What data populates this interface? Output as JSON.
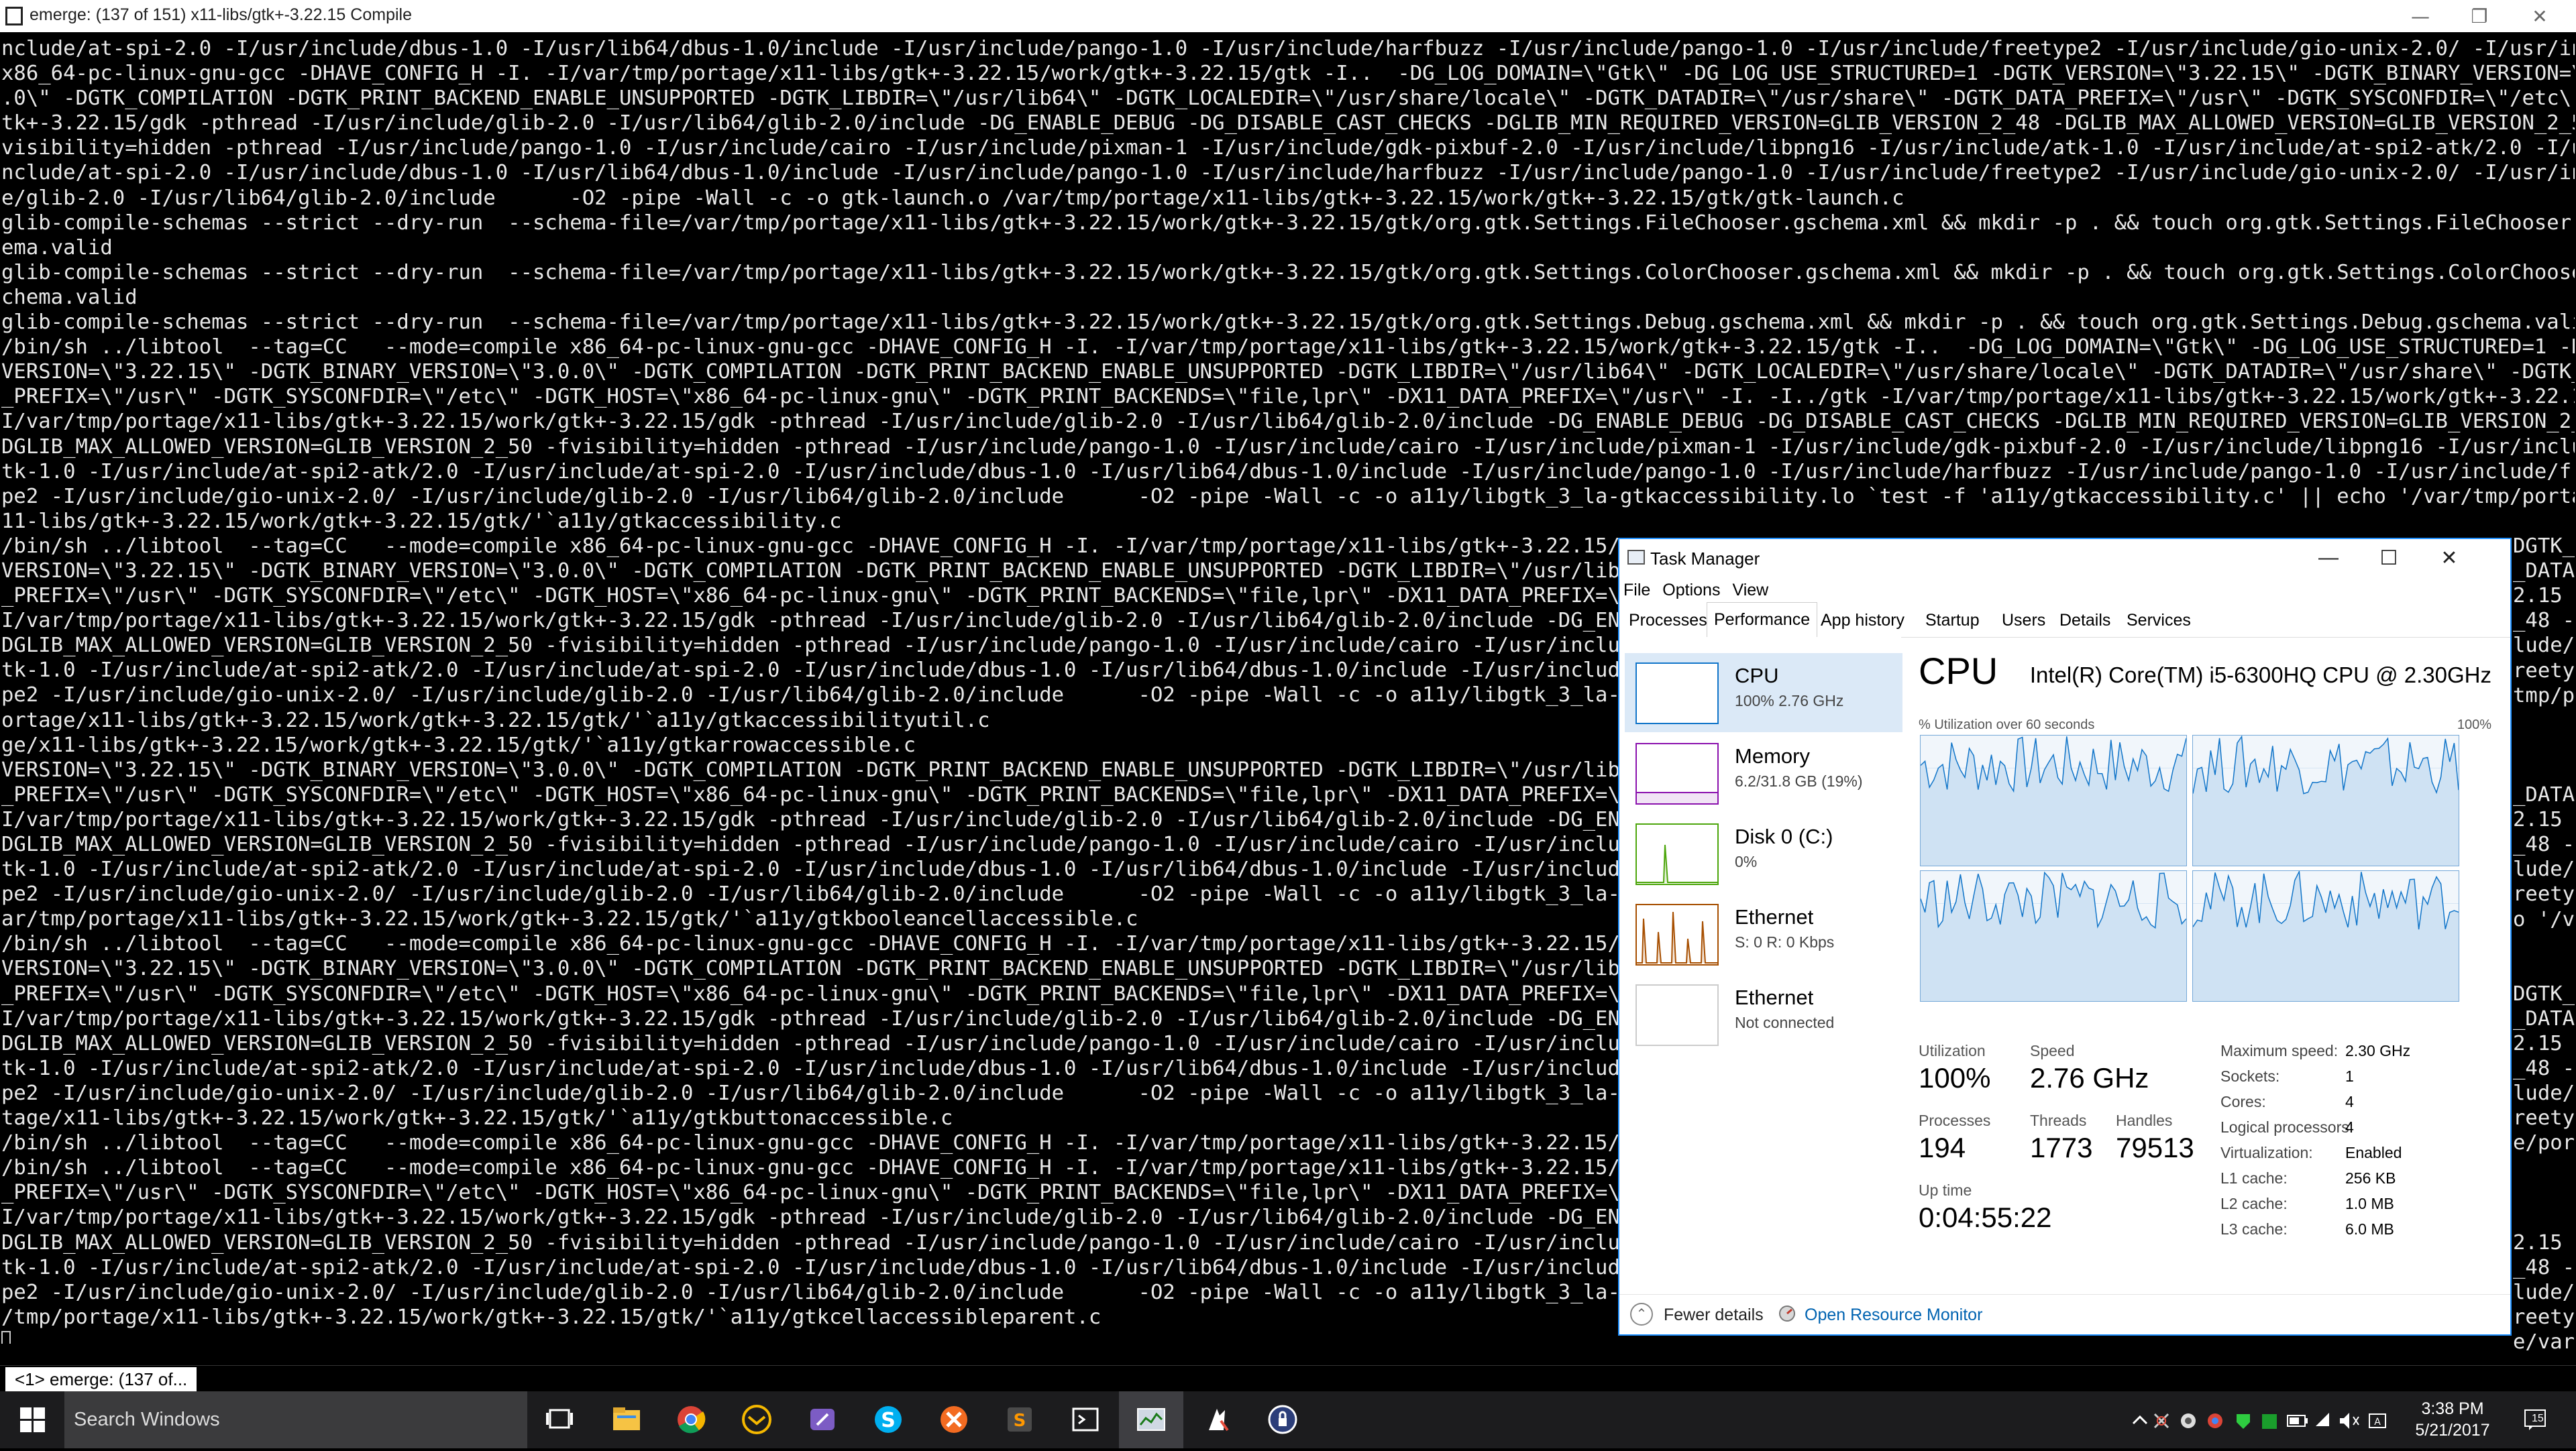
{
  "terminal": {
    "title": "emerge: (137 of 151) x11-libs/gtk+-3.22.15 Compile",
    "tab_label": "<1> emerge: (137 of...",
    "lines": [
      "nclude/at-spi-2.0 -I/usr/include/dbus-1.0 -I/usr/lib64/dbus-1.0/include -I/usr/include/pango-1.0 -I/usr/include/harfbuzz -I/usr/include/pango-1.0 -I/usr/include/freetype2 -I/usr/include/gio-unix-2.0/ -I/usr/includ",
      "x86_64-pc-linux-gnu-gcc -DHAVE_CONFIG_H -I. -I/var/tmp/portage/x11-libs/gtk+-3.22.15/work/gtk+-3.22.15/gtk -I..  -DG_LOG_DOMAIN=\\\"Gtk\\\" -DG_LOG_USE_STRUCTURED=1 -DGTK_VERSION=\\\"3.22.15\\\" -DGTK_BINARY_VERSION=\\\"3.0",
      ".0\\\" -DGTK_COMPILATION -DGTK_PRINT_BACKEND_ENABLE_UNSUPPORTED -DGTK_LIBDIR=\\\"/usr/lib64\\\" -DGTK_LOCALEDIR=\\\"/usr/share/locale\\\" -DGTK_DATADIR=\\\"/usr/share\\\" -DGTK_DATA_PREFIX=\\\"/usr\\\" -DGTK_SYSCONFDIR=\\\"/etc\\\" -D",
      "tk+-3.22.15/gdk -pthread -I/usr/include/glib-2.0 -I/usr/lib64/glib-2.0/include -DG_ENABLE_DEBUG -DG_DISABLE_CAST_CHECKS -DGLIB_MIN_REQUIRED_VERSION=GLIB_VERSION_2_48 -DGLIB_MAX_ALLOWED_VERSION=GLIB_VERSION_2_50 -f",
      "visibility=hidden -pthread -I/usr/include/pango-1.0 -I/usr/include/cairo -I/usr/include/pixman-1 -I/usr/include/gdk-pixbuf-2.0 -I/usr/include/libpng16 -I/usr/include/atk-1.0 -I/usr/include/at-spi2-atk/2.0 -I/usr/i",
      "nclude/at-spi-2.0 -I/usr/include/dbus-1.0 -I/usr/lib64/dbus-1.0/include -I/usr/include/pango-1.0 -I/usr/include/harfbuzz -I/usr/include/pango-1.0 -I/usr/include/freetype2 -I/usr/include/gio-unix-2.0/ -I/usr/includ",
      "e/glib-2.0 -I/usr/lib64/glib-2.0/include      -O2 -pipe -Wall -c -o gtk-launch.o /var/tmp/portage/x11-libs/gtk+-3.22.15/work/gtk+-3.22.15/gtk/gtk-launch.c",
      "glib-compile-schemas --strict --dry-run  --schema-file=/var/tmp/portage/x11-libs/gtk+-3.22.15/work/gtk+-3.22.15/gtk/org.gtk.Settings.FileChooser.gschema.xml && mkdir -p . && touch org.gtk.Settings.FileChooser.gsch",
      "ema.valid",
      "glib-compile-schemas --strict --dry-run  --schema-file=/var/tmp/portage/x11-libs/gtk+-3.22.15/work/gtk+-3.22.15/gtk/org.gtk.Settings.ColorChooser.gschema.xml && mkdir -p . && touch org.gtk.Settings.ColorChooser.gs",
      "chema.valid",
      "glib-compile-schemas --strict --dry-run  --schema-file=/var/tmp/portage/x11-libs/gtk+-3.22.15/work/gtk+-3.22.15/gtk/org.gtk.Settings.Debug.gschema.xml && mkdir -p . && touch org.gtk.Settings.Debug.gschema.valid",
      "/bin/sh ../libtool  --tag=CC   --mode=compile x86_64-pc-linux-gnu-gcc -DHAVE_CONFIG_H -I. -I/var/tmp/portage/x11-libs/gtk+-3.22.15/work/gtk+-3.22.15/gtk -I..  -DG_LOG_DOMAIN=\\\"Gtk\\\" -DG_LOG_USE_STRUCTURED=1 -DGTK_",
      "VERSION=\\\"3.22.15\\\" -DGTK_BINARY_VERSION=\\\"3.0.0\\\" -DGTK_COMPILATION -DGTK_PRINT_BACKEND_ENABLE_UNSUPPORTED -DGTK_LIBDIR=\\\"/usr/lib64\\\" -DGTK_LOCALEDIR=\\\"/usr/share/locale\\\" -DGTK_DATADIR=\\\"/usr/share\\\" -DGTK_DATA",
      "_PREFIX=\\\"/usr\\\" -DGTK_SYSCONFDIR=\\\"/etc\\\" -DGTK_HOST=\\\"x86_64-pc-linux-gnu\\\" -DGTK_PRINT_BACKENDS=\\\"file,lpr\\\" -DX11_DATA_PREFIX=\\\"/usr\\\" -I. -I../gtk -I/var/tmp/portage/x11-libs/gtk+-3.22.15/work/gtk+-3.22.15",
      "I/var/tmp/portage/x11-libs/gtk+-3.22.15/work/gtk+-3.22.15/gdk -pthread -I/usr/include/glib-2.0 -I/usr/lib64/glib-2.0/include -DG_ENABLE_DEBUG -DG_DISABLE_CAST_CHECKS -DGLIB_MIN_REQUIRED_VERSION=GLIB_VERSION_2_48 -",
      "DGLIB_MAX_ALLOWED_VERSION=GLIB_VERSION_2_50 -fvisibility=hidden -pthread -I/usr/include/pango-1.0 -I/usr/include/cairo -I/usr/include/pixman-1 -I/usr/include/gdk-pixbuf-2.0 -I/usr/include/libpng16 -I/usr/include/a",
      "tk-1.0 -I/usr/include/at-spi2-atk/2.0 -I/usr/include/at-spi-2.0 -I/usr/include/dbus-1.0 -I/usr/lib64/dbus-1.0/include -I/usr/include/pango-1.0 -I/usr/include/harfbuzz -I/usr/include/pango-1.0 -I/usr/include/freety",
      "pe2 -I/usr/include/gio-unix-2.0/ -I/usr/include/glib-2.0 -I/usr/lib64/glib-2.0/include      -O2 -pipe -Wall -c -o a11y/libgtk_3_la-gtkaccessibility.lo `test -f 'a11y/gtkaccessibility.c' || echo '/var/tmp/portage/x",
      "11-libs/gtk+-3.22.15/work/gtk+-3.22.15/gtk/'`a11y/gtkaccessibility.c",
      "/bin/sh ../libtool  --tag=CC   --mode=compile x86_64-pc-linux-gnu-gcc -DHAVE_CONFIG_H -I. -I/var/tmp/portage/x11-libs/gtk+-3.22.15/wor",
      "VERSION=\\\"3.22.15\\\" -DGTK_BINARY_VERSION=\\\"3.0.0\\\" -DGTK_COMPILATION -DGTK_PRINT_BACKEND_ENABLE_UNSUPPORTED -DGTK_LIBDIR=\\\"/usr/lib64",
      "_PREFIX=\\\"/usr\\\" -DGTK_SYSCONFDIR=\\\"/etc\\\" -DGTK_HOST=\\\"x86_64-pc-linux-gnu\\\" -DGTK_PRINT_BACKENDS=\\\"file,lpr\\\" -DX11_DATA_PREFIX=\\\"/u",
      "I/var/tmp/portage/x11-libs/gtk+-3.22.15/work/gtk+-3.22.15/gdk -pthread -I/usr/include/glib-2.0 -I/usr/lib64/glib-2.0/include -DG_ENABL",
      "DGLIB_MAX_ALLOWED_VERSION=GLIB_VERSION_2_50 -fvisibility=hidden -pthread -I/usr/include/pango-1.0 -I/usr/include/cairo -I/usr/include",
      "tk-1.0 -I/usr/include/at-spi2-atk/2.0 -I/usr/include/at-spi-2.0 -I/usr/include/dbus-1.0 -I/usr/lib64/dbus-1.0/include -I/usr/include/p",
      "pe2 -I/usr/include/gio-unix-2.0/ -I/usr/include/glib-2.0 -I/usr/lib64/glib-2.0/include      -O2 -pipe -Wall -c -o a11y/libgtk_3_la-gt",
      "ortage/x11-libs/gtk+-3.22.15/work/gtk+-3.22.15/gtk/'`a11y/gtkaccessibilityutil.c",
      "ge/x11-libs/gtk+-3.22.15/work/gtk+-3.22.15/gtk/'`a11y/gtkarrowaccessible.c",
      "VERSION=\\\"3.22.15\\\" -DGTK_BINARY_VERSION=\\\"3.0.0\\\" -DGTK_COMPILATION -DGTK_PRINT_BACKEND_ENABLE_UNSUPPORTED -DGTK_LIBDIR=\\\"/usr/lib64",
      "_PREFIX=\\\"/usr\\\" -DGTK_SYSCONFDIR=\\\"/etc\\\" -DGTK_HOST=\\\"x86_64-pc-linux-gnu\\\" -DGTK_PRINT_BACKENDS=\\\"file,lpr\\\" -DX11_DATA_PREFIX=\\\"/u",
      "I/var/tmp/portage/x11-libs/gtk+-3.22.15/work/gtk+-3.22.15/gdk -pthread -I/usr/include/glib-2.0 -I/usr/lib64/glib-2.0/include -DG_ENABL",
      "DGLIB_MAX_ALLOWED_VERSION=GLIB_VERSION_2_50 -fvisibility=hidden -pthread -I/usr/include/pango-1.0 -I/usr/include/cairo -I/usr/include",
      "tk-1.0 -I/usr/include/at-spi2-atk/2.0 -I/usr/include/at-spi-2.0 -I/usr/include/dbus-1.0 -I/usr/lib64/dbus-1.0/include -I/usr/include/p",
      "pe2 -I/usr/include/gio-unix-2.0/ -I/usr/include/glib-2.0 -I/usr/lib64/glib-2.0/include      -O2 -pipe -Wall -c -o a11y/libgtk_3_la-gt",
      "ar/tmp/portage/x11-libs/gtk+-3.22.15/work/gtk+-3.22.15/gtk/'`a11y/gtkbooleancellaccessible.c",
      "/bin/sh ../libtool  --tag=CC   --mode=compile x86_64-pc-linux-gnu-gcc -DHAVE_CONFIG_H -I. -I/var/tmp/portage/x11-libs/gtk+-3.22.15/wor",
      "VERSION=\\\"3.22.15\\\" -DGTK_BINARY_VERSION=\\\"3.0.0\\\" -DGTK_COMPILATION -DGTK_PRINT_BACKEND_ENABLE_UNSUPPORTED -DGTK_LIBDIR=\\\"/usr/lib64",
      "_PREFIX=\\\"/usr\\\" -DGTK_SYSCONFDIR=\\\"/etc\\\" -DGTK_HOST=\\\"x86_64-pc-linux-gnu\\\" -DGTK_PRINT_BACKENDS=\\\"file,lpr\\\" -DX11_DATA_PREFIX=\\\"/u",
      "I/var/tmp/portage/x11-libs/gtk+-3.22.15/work/gtk+-3.22.15/gdk -pthread -I/usr/include/glib-2.0 -I/usr/lib64/glib-2.0/include -DG_ENABL",
      "DGLIB_MAX_ALLOWED_VERSION=GLIB_VERSION_2_50 -fvisibility=hidden -pthread -I/usr/include/pango-1.0 -I/usr/include/cairo -I/usr/include",
      "tk-1.0 -I/usr/include/at-spi2-atk/2.0 -I/usr/include/at-spi-2.0 -I/usr/include/dbus-1.0 -I/usr/lib64/dbus-1.0/include -I/usr/include/p",
      "pe2 -I/usr/include/gio-unix-2.0/ -I/usr/include/glib-2.0 -I/usr/lib64/glib-2.0/include      -O2 -pipe -Wall -c -o a11y/libgtk_3_la-gt",
      "tage/x11-libs/gtk+-3.22.15/work/gtk+-3.22.15/gtk/'`a11y/gtkbuttonaccessible.c",
      "/bin/sh ../libtool  --tag=CC   --mode=compile x86_64-pc-linux-gnu-gcc -DHAVE_CONFIG_H -I. -I/var/tmp/portage/x11-libs/gtk+-3.22.15/wor",
      "/bin/sh ../libtool  --tag=CC   --mode=compile x86_64-pc-linux-gnu-gcc -DHAVE_CONFIG_H -I. -I/var/tmp/portage/x11-libs/gtk+-3.22.15/wor",
      "_PREFIX=\\\"/usr\\\" -DGTK_SYSCONFDIR=\\\"/etc\\\" -DGTK_HOST=\\\"x86_64-pc-linux-gnu\\\" -DGTK_PRINT_BACKENDS=\\\"file,lpr\\\" -DX11_DATA_PREFIX=\\\"/u",
      "I/var/tmp/portage/x11-libs/gtk+-3.22.15/work/gtk+-3.22.15/gdk -pthread -I/usr/include/glib-2.0 -I/usr/lib64/glib-2.0/include -DG_ENABL",
      "DGLIB_MAX_ALLOWED_VERSION=GLIB_VERSION_2_50 -fvisibility=hidden -pthread -I/usr/include/pango-1.0 -I/usr/include/cairo -I/usr/include",
      "tk-1.0 -I/usr/include/at-spi2-atk/2.0 -I/usr/include/at-spi-2.0 -I/usr/include/dbus-1.0 -I/usr/lib64/dbus-1.0/include -I/usr/include/p",
      "pe2 -I/usr/include/gio-unix-2.0/ -I/usr/include/glib-2.0 -I/usr/lib64/glib-2.0/include      -O2 -pipe -Wall -c -o a11y/libgtk_3_la-gt",
      "/tmp/portage/x11-libs/gtk+-3.22.15/work/gtk+-3.22.15/gtk/'`a11y/gtkcellaccessibleparent.c"
    ],
    "right_fragments": [
      {
        "line": 20,
        "text": "DGTK_"
      },
      {
        "line": 21,
        "text": "_DATA"
      },
      {
        "line": 22,
        "text": "2.15 -"
      },
      {
        "line": 23,
        "text": "_48 -"
      },
      {
        "line": 24,
        "text": "lude/a"
      },
      {
        "line": 25,
        "text": "reety"
      },
      {
        "line": 26,
        "text": "tmp/p"
      },
      {
        "line": 30,
        "text": "_DATA"
      },
      {
        "line": 31,
        "text": "2.15 -"
      },
      {
        "line": 32,
        "text": "_48 -"
      },
      {
        "line": 33,
        "text": "lude/a"
      },
      {
        "line": 34,
        "text": "reety"
      },
      {
        "line": 35,
        "text": "o '/v"
      },
      {
        "line": 38,
        "text": "DGTK_"
      },
      {
        "line": 39,
        "text": "_DATA"
      },
      {
        "line": 40,
        "text": "2.15 -"
      },
      {
        "line": 41,
        "text": "_48 -"
      },
      {
        "line": 42,
        "text": "lude/a"
      },
      {
        "line": 43,
        "text": "reety"
      },
      {
        "line": 44,
        "text": "e/por"
      },
      {
        "line": 48,
        "text": "2.15 -"
      },
      {
        "line": 49,
        "text": "_48 -"
      },
      {
        "line": 50,
        "text": "lude/a"
      },
      {
        "line": 51,
        "text": "reety"
      },
      {
        "line": 52,
        "text": "e/var"
      }
    ]
  },
  "taskmanager": {
    "title": "Task Manager",
    "menu": [
      "File",
      "Options",
      "View"
    ],
    "tabs": [
      "Processes",
      "Performance",
      "App history",
      "Startup",
      "Users",
      "Details",
      "Services"
    ],
    "active_tab": "Performance",
    "sidebar": [
      {
        "name": "CPU",
        "sub": "100% 2.76 GHz",
        "color": "#1175c9",
        "selected": true
      },
      {
        "name": "Memory",
        "sub": "6.2/31.8 GB (19%)",
        "color": "#8b12ae"
      },
      {
        "name": "Disk 0 (C:)",
        "sub": "0%",
        "color": "#4da60c"
      },
      {
        "name": "Ethernet",
        "sub": "S: 0 R: 0 Kbps",
        "color": "#a74f01"
      },
      {
        "name": "Ethernet",
        "sub": "Not connected",
        "color": "#a74f01"
      }
    ],
    "cpu": {
      "title": "CPU",
      "model": "Intel(R) Core(TM) i5-6300HQ CPU @ 2.30GHz",
      "graph_label": "% Utilization over 60 seconds",
      "graph_max": "100%",
      "stats": [
        {
          "label": "Utilization",
          "value": "100%"
        },
        {
          "label": "Speed",
          "value": "2.76 GHz"
        },
        {
          "label": "Processes",
          "value": "194"
        },
        {
          "label": "Threads",
          "value": "1773"
        },
        {
          "label": "Handles",
          "value": "79513"
        },
        {
          "label": "Up time",
          "value": "0:04:55:22"
        }
      ],
      "specs": [
        {
          "label": "Maximum speed:",
          "value": "2.30 GHz"
        },
        {
          "label": "Sockets:",
          "value": "1"
        },
        {
          "label": "Cores:",
          "value": "4"
        },
        {
          "label": "Logical processors:",
          "value": "4"
        },
        {
          "label": "Virtualization:",
          "value": "Enabled"
        },
        {
          "label": "L1 cache:",
          "value": "256 KB"
        },
        {
          "label": "L2 cache:",
          "value": "1.0 MB"
        },
        {
          "label": "L3 cache:",
          "value": "6.0 MB"
        }
      ]
    },
    "footer": {
      "fewer_details": "Fewer details",
      "open_resource_monitor": "Open Resource Monitor"
    }
  },
  "taskbar": {
    "search_placeholder": "Search Windows",
    "apps": [
      "task-view-icon",
      "file-explorer-icon",
      "chrome-icon",
      "email-icon",
      "paint-icon",
      "skype-icon",
      "xmind-icon",
      "sublime-icon",
      "terminal-icon",
      "task-manager-icon",
      "cygwin-icon",
      "vpn-icon"
    ],
    "time": "3:38 PM",
    "date": "5/21/2017",
    "notification_count": "15"
  }
}
